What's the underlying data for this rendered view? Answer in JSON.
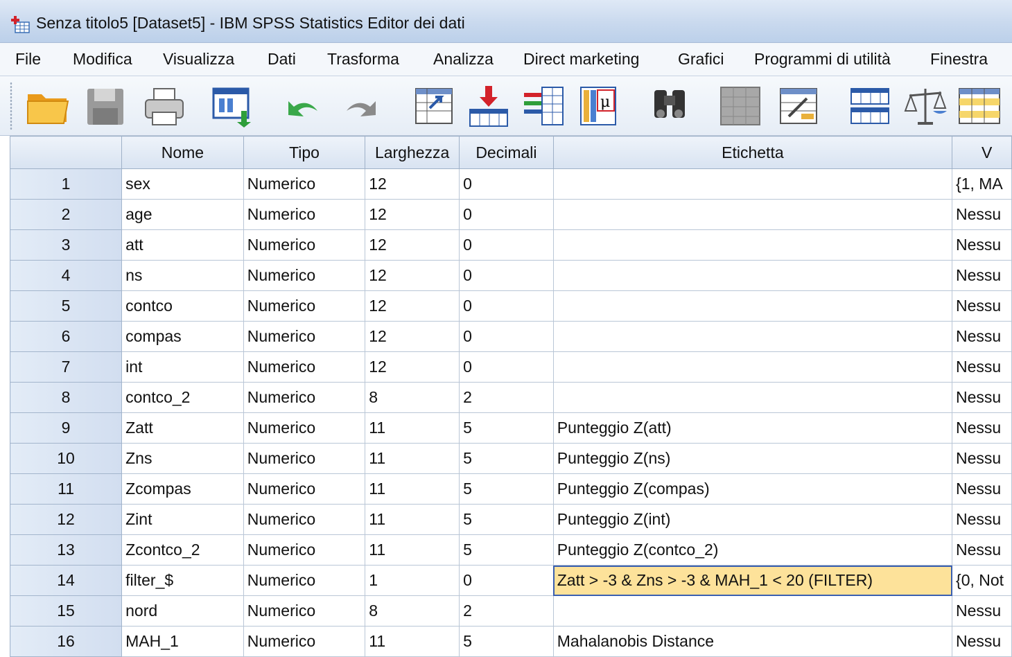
{
  "window": {
    "title": "Senza titolo5 [Dataset5] - IBM SPSS Statistics Editor dei dati"
  },
  "menu": [
    "File",
    "Modifica",
    "Visualizza",
    "Dati",
    "Trasforma",
    "Analizza",
    "Direct marketing",
    "Grafici",
    "Programmi di utilità",
    "Finestra"
  ],
  "toolbar": {
    "buttons": [
      "open-folder-icon",
      "save-icon",
      "print-icon",
      "dialog-recall-icon",
      "undo-icon",
      "redo-icon",
      "goto-case-icon",
      "goto-variable-icon",
      "variables-icon",
      "run-descriptives-icon",
      "find-icon",
      "insert-cases-icon",
      "insert-variable-icon",
      "split-file-icon",
      "weight-cases-icon",
      "select-cases-icon"
    ]
  },
  "grid": {
    "columns": [
      "Nome",
      "Tipo",
      "Larghezza",
      "Decimali",
      "Etichetta",
      "V"
    ],
    "rows": [
      {
        "num": "1",
        "nome": "sex",
        "tipo": "Numerico",
        "larghezza": "12",
        "decimali": "0",
        "etichetta": "",
        "valori": "{1, MA"
      },
      {
        "num": "2",
        "nome": "age",
        "tipo": "Numerico",
        "larghezza": "12",
        "decimali": "0",
        "etichetta": "",
        "valori": "Nessu"
      },
      {
        "num": "3",
        "nome": "att",
        "tipo": "Numerico",
        "larghezza": "12",
        "decimali": "0",
        "etichetta": "",
        "valori": "Nessu"
      },
      {
        "num": "4",
        "nome": "ns",
        "tipo": "Numerico",
        "larghezza": "12",
        "decimali": "0",
        "etichetta": "",
        "valori": "Nessu"
      },
      {
        "num": "5",
        "nome": "contco",
        "tipo": "Numerico",
        "larghezza": "12",
        "decimali": "0",
        "etichetta": "",
        "valori": "Nessu"
      },
      {
        "num": "6",
        "nome": "compas",
        "tipo": "Numerico",
        "larghezza": "12",
        "decimali": "0",
        "etichetta": "",
        "valori": "Nessu"
      },
      {
        "num": "7",
        "nome": "int",
        "tipo": "Numerico",
        "larghezza": "12",
        "decimali": "0",
        "etichetta": "",
        "valori": "Nessu"
      },
      {
        "num": "8",
        "nome": "contco_2",
        "tipo": "Numerico",
        "larghezza": "8",
        "decimali": "2",
        "etichetta": "",
        "valori": "Nessu"
      },
      {
        "num": "9",
        "nome": "Zatt",
        "tipo": "Numerico",
        "larghezza": "11",
        "decimali": "5",
        "etichetta": "Punteggio Z(att)",
        "valori": "Nessu"
      },
      {
        "num": "10",
        "nome": "Zns",
        "tipo": "Numerico",
        "larghezza": "11",
        "decimali": "5",
        "etichetta": "Punteggio Z(ns)",
        "valori": "Nessu"
      },
      {
        "num": "11",
        "nome": "Zcompas",
        "tipo": "Numerico",
        "larghezza": "11",
        "decimali": "5",
        "etichetta": "Punteggio Z(compas)",
        "valori": "Nessu"
      },
      {
        "num": "12",
        "nome": "Zint",
        "tipo": "Numerico",
        "larghezza": "11",
        "decimali": "5",
        "etichetta": "Punteggio Z(int)",
        "valori": "Nessu"
      },
      {
        "num": "13",
        "nome": "Zcontco_2",
        "tipo": "Numerico",
        "larghezza": "11",
        "decimali": "5",
        "etichetta": "Punteggio Z(contco_2)",
        "valori": "Nessu"
      },
      {
        "num": "14",
        "nome": "filter_$",
        "tipo": "Numerico",
        "larghezza": "1",
        "decimali": "0",
        "etichetta": "Zatt > -3 & Zns > -3 & MAH_1 < 20 (FILTER)",
        "valori": "{0, Not"
      },
      {
        "num": "15",
        "nome": "nord",
        "tipo": "Numerico",
        "larghezza": "8",
        "decimali": "2",
        "etichetta": "",
        "valori": "Nessu"
      },
      {
        "num": "16",
        "nome": "MAH_1",
        "tipo": "Numerico",
        "larghezza": "11",
        "decimali": "5",
        "etichetta": "Mahalanobis Distance",
        "valori": "Nessu"
      }
    ],
    "selected_row": "14",
    "selected_column": "Etichetta",
    "selection_color": "#fde29a"
  }
}
